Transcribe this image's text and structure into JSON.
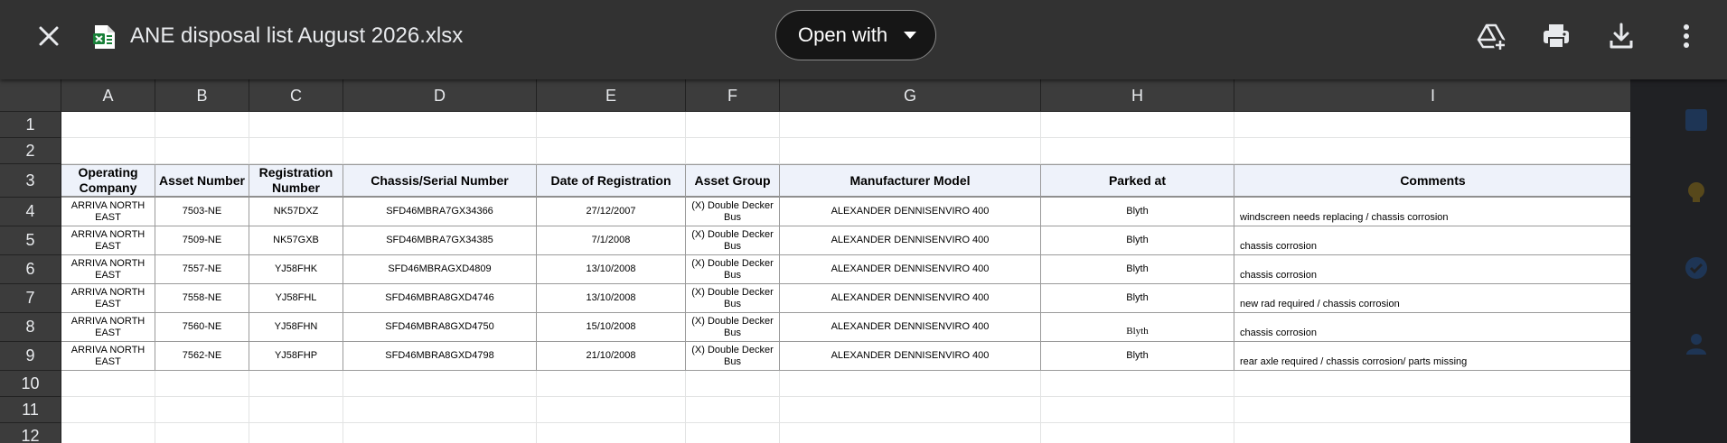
{
  "topbar": {
    "file_name": "ANE disposal list August 2026.xlsx",
    "open_with_label": "Open with"
  },
  "icons": {
    "close": "close-icon",
    "file": "sheets-file-icon",
    "caret": "caret-down-icon",
    "drive": "add-to-drive-icon",
    "print": "print-icon",
    "download": "download-icon",
    "more": "more-vert-icon"
  },
  "colors": {
    "topbar_bg": "#323232",
    "header_fill": "#eef2fa",
    "sheets_green": "#188038"
  },
  "sheet": {
    "columns": [
      "A",
      "B",
      "C",
      "D",
      "E",
      "F",
      "G",
      "H",
      "I"
    ],
    "rows": [
      "1",
      "2",
      "3",
      "4",
      "5",
      "6",
      "7",
      "8",
      "9",
      "10",
      "11",
      "12"
    ],
    "headers": [
      "Operating Company",
      "Asset Number",
      "Registration Number",
      "Chassis/Serial Number",
      "Date of Registration",
      "Asset Group",
      "Manufacturer Model",
      "Parked at",
      "Comments"
    ],
    "data": [
      [
        "ARRIVA NORTH EAST",
        "7503-NE",
        "NK57DXZ",
        "SFD46MBRA7GX34366",
        "27/12/2007",
        "(X) Double Decker Bus",
        "ALEXANDER DENNISENVIRO 400",
        "Blyth",
        "windscreen needs replacing / chassis corrosion"
      ],
      [
        "ARRIVA NORTH EAST",
        "7509-NE",
        "NK57GXB",
        "SFD46MBRA7GX34385",
        "7/1/2008",
        "(X) Double Decker Bus",
        "ALEXANDER DENNISENVIRO 400",
        "Blyth",
        "chassis corrosion"
      ],
      [
        "ARRIVA NORTH EAST",
        "7557-NE",
        "YJ58FHK",
        "SFD46MBRAGXD4809",
        "13/10/2008",
        "(X) Double Decker Bus",
        "ALEXANDER DENNISENVIRO 400",
        "Blyth",
        "chassis corrosion"
      ],
      [
        "ARRIVA NORTH EAST",
        "7558-NE",
        "YJ58FHL",
        "SFD46MBRA8GXD4746",
        "13/10/2008",
        "(X) Double Decker Bus",
        "ALEXANDER DENNISENVIRO 400",
        "Blyth",
        "new rad required / chassis corrosion"
      ],
      [
        "ARRIVA NORTH EAST",
        "7560-NE",
        "YJ58FHN",
        "SFD46MBRA8GXD4750",
        "15/10/2008",
        "(X) Double Decker Bus",
        "ALEXANDER DENNISENVIRO 400",
        "Blyth",
        "chassis corrosion"
      ],
      [
        "ARRIVA NORTH EAST",
        "7562-NE",
        "YJ58FHP",
        "SFD46MBRA8GXD4798",
        "21/10/2008",
        "(X) Double Decker Bus",
        "ALEXANDER DENNISENVIRO 400",
        "Blyth",
        "rear axle required / chassis corrosion/ parts missing"
      ]
    ]
  }
}
